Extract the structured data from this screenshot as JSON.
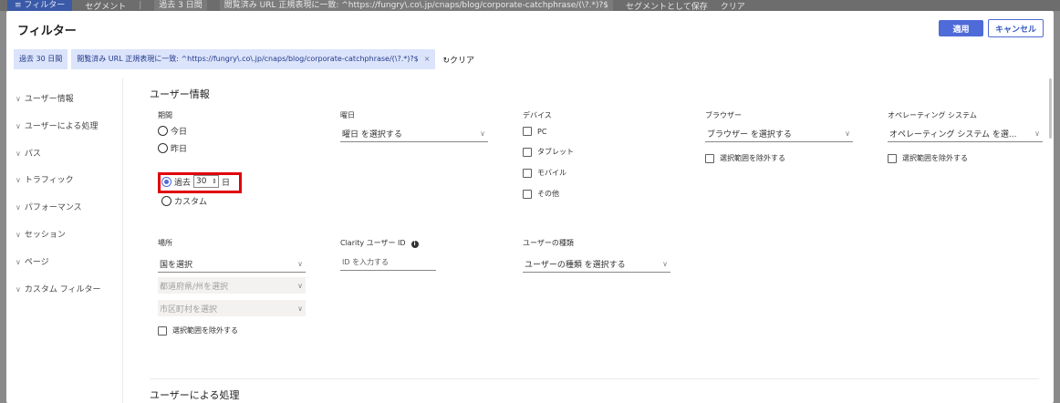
{
  "background": {
    "filter_pill": "≡ フィルター",
    "segment": "セグメント",
    "filter_summary": "過去 3 日間",
    "url_summary": "閲覧済み URL 正規表現に一致: ^https://fungry\\.co\\.jp/cnaps/blog/corporate-catchphrase/(\\?.*)?$",
    "save_segment": "セグメントとして保存",
    "clear": "クリア"
  },
  "dialog": {
    "title": "フィルター",
    "apply_label": "適用",
    "cancel_label": "キャンセル"
  },
  "chips": [
    {
      "label": "過去 30 日間"
    },
    {
      "label": "閲覧済み URL 正規表現に一致: ^https://fungry\\.co\\.jp/cnaps/blog/corporate-catchphrase/(\\?.*)?$"
    }
  ],
  "clear_label": "クリア",
  "sidebar": {
    "items": [
      {
        "label": "ユーザー情報"
      },
      {
        "label": "ユーザーによる処理"
      },
      {
        "label": "パス"
      },
      {
        "label": "トラフィック"
      },
      {
        "label": "パフォーマンス"
      },
      {
        "label": "セッション"
      },
      {
        "label": "ページ"
      },
      {
        "label": "カスタム フィルター"
      }
    ]
  },
  "user_info": {
    "title": "ユーザー情報",
    "period": {
      "label": "期間",
      "options": {
        "today": "今日",
        "yesterday": "昨日",
        "past_prefix": "過去",
        "past_value": "30",
        "past_suffix": "日",
        "custom": "カスタム"
      },
      "selected": "past"
    },
    "weekday": {
      "label": "曜日",
      "placeholder": "曜日 を選択する"
    },
    "device": {
      "label": "デバイス",
      "options": [
        "PC",
        "タブレット",
        "モバイル",
        "その他"
      ]
    },
    "browser": {
      "label": "ブラウザー",
      "placeholder": "ブラウザー を選択する",
      "exclude": "選択範囲を除外する"
    },
    "os": {
      "label": "オペレーティング システム",
      "placeholder": "オペレーティング システム を選...",
      "exclude": "選択範囲を除外する"
    },
    "location": {
      "label": "場所",
      "country": "国を選択",
      "state": "都道府県/州を選択",
      "city": "市区町村を選択",
      "exclude": "選択範囲を除外する"
    },
    "clarity_id": {
      "label": "Clarity ユーザー ID",
      "placeholder": "ID を入力する"
    },
    "user_type": {
      "label": "ユーザーの種類",
      "placeholder": "ユーザーの種類 を選択する"
    }
  },
  "user_actions": {
    "title": "ユーザーによる処理"
  },
  "colors": {
    "accent": "#4f6bd8",
    "highlight": "#e0000a",
    "chip_bg": "#dbe4fb"
  }
}
